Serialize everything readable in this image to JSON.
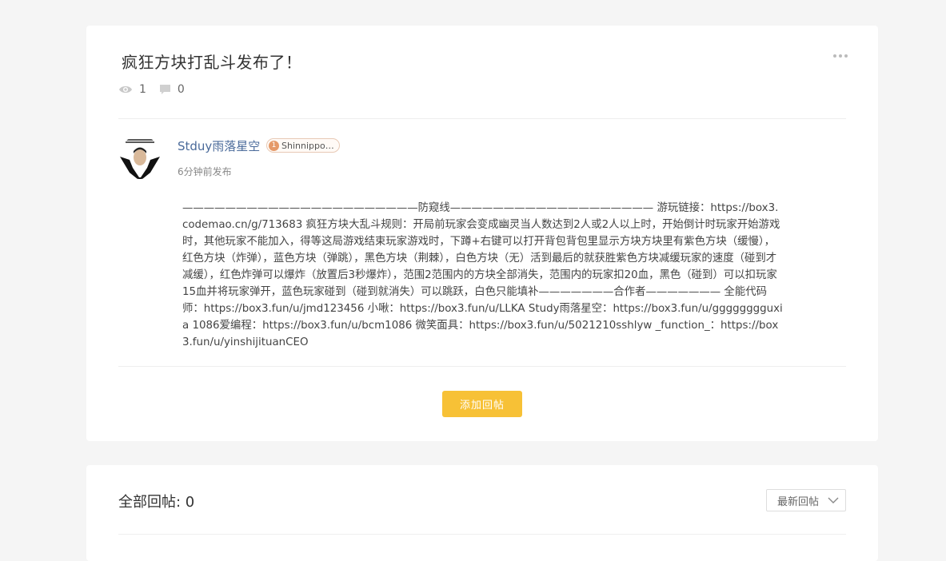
{
  "post": {
    "title": "疯狂方块打乱斗发布了！",
    "views": "1",
    "comments": "0",
    "more_icon": "more-dots-icon",
    "author": {
      "name": "Stduy雨落星空",
      "badge_level": "1",
      "badge_text": "Shinnippori...",
      "posted": "6分钟前发布"
    },
    "body": "——————————————————————防窥线——————————————————— 游玩链接：https://box3.codemao.cn/g/713683 疯狂方块大乱斗规则：开局前玩家会变成幽灵当人数达到2人或2人以上时，开始倒计时玩家开始游戏时，其他玩家不能加入，得等这局游戏结束玩家游戏时，下蹲+右键可以打开背包背包里显示方块方块里有紫色方块（缓慢），红色方块（炸弹），蓝色方块（弹跳），黑色方块（荆棘），白色方块（无）活到最后的就获胜紫色方块减缓玩家的速度（碰到才减缓），红色炸弹可以爆炸（放置后3秒爆炸），范围2范围内的方块全部消失，范围内的玩家扣20血，黑色（碰到）可以扣玩家15血并将玩家弹开，蓝色玩家碰到（碰到就消失）可以跳跃，白色只能填补———————合作者——————— 全能代码师：https://box3.fun/u/jmd123456 小啾：https://box3.fun/u/LLKA Study雨落星空：https://box3.fun/u/gggggggguxia 1086爱编程：https://box3.fun/u/bcm1086 微笑面具：https://box3.fun/u/5021210sshlyw _function_：https://box3.fun/u/yinshijituanCEO",
    "reply_button": "添加回帖"
  },
  "replies": {
    "title": "全部回帖: 0",
    "sort_selected": "最新回帖"
  },
  "colors": {
    "accent": "#f7c136",
    "author_link": "#4a6a9a",
    "background": "#f5f5f5"
  }
}
